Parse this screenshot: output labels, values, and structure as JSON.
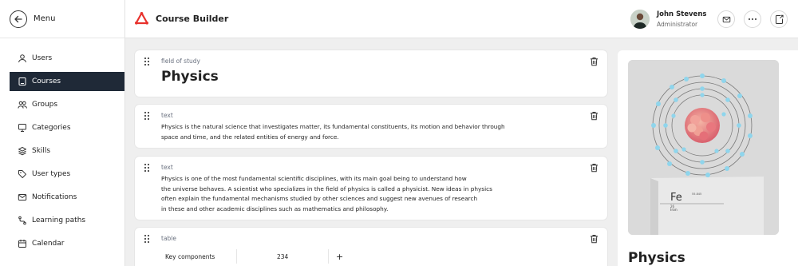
{
  "sidebar": {
    "menu_label": "Menu",
    "items": [
      {
        "label": "Users",
        "icon": "user-icon",
        "active": false
      },
      {
        "label": "Courses",
        "icon": "book-icon",
        "active": true
      },
      {
        "label": "Groups",
        "icon": "groups-icon",
        "active": false
      },
      {
        "label": "Categories",
        "icon": "categories-icon",
        "active": false
      },
      {
        "label": "Skills",
        "icon": "skills-icon",
        "active": false
      },
      {
        "label": "User types",
        "icon": "tag-icon",
        "active": false
      },
      {
        "label": "Notifications",
        "icon": "mail-icon",
        "active": false
      },
      {
        "label": "Learning paths",
        "icon": "path-icon",
        "active": false
      },
      {
        "label": "Calendar",
        "icon": "calendar-icon",
        "active": false
      }
    ]
  },
  "header": {
    "title": "Course Builder",
    "user_name": "John Stevens",
    "user_role": "Administrator",
    "brand_color": "#e8322d"
  },
  "blocks": [
    {
      "type_label": "field of study",
      "title": "Physics"
    },
    {
      "type_label": "text",
      "lines": [
        "Physics is the natural science that investigates matter, its fundamental constituents, its motion and behavior through",
        "space and time, and the related entities of energy and force."
      ]
    },
    {
      "type_label": "text",
      "lines": [
        "Physics is one of the most fundamental scientific disciplines, with its main goal being to understand how",
        "the universe behaves. A scientist who specializes in the field of physics is called a physicist. New ideas in physics",
        "often explain the fundamental mechanisms studied by other sciences and suggest new avenues of research",
        "in these and other academic disciplines such as mathematics and philosophy."
      ]
    },
    {
      "type_label": "table",
      "row": {
        "label": "Key components",
        "value": "234",
        "add": "+"
      }
    }
  ],
  "preview": {
    "title": "Physics",
    "element_symbol": "Fe",
    "element_name": "Iron",
    "element_number": "26",
    "element_mass": "55.845"
  }
}
